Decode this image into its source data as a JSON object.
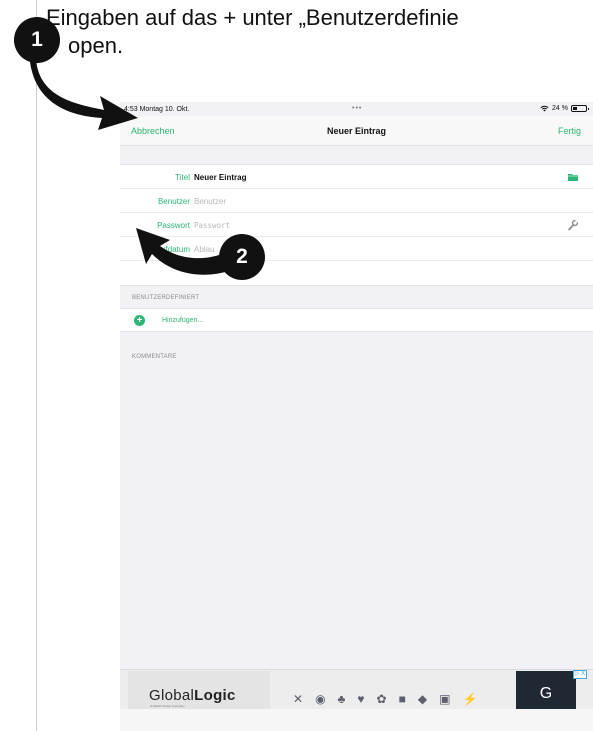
{
  "instruction": {
    "line1": "Eingaben auf das + unter „Benutzerdefinie",
    "line2": "open."
  },
  "callouts": {
    "one": "1",
    "two": "2"
  },
  "statusbar": {
    "time": "4:53",
    "date": "Montag 10. Okt.",
    "dots": "•••",
    "battery": "24 %"
  },
  "navbar": {
    "cancel": "Abbrechen",
    "title": "Neuer Eintrag",
    "done": "Fertig"
  },
  "form": {
    "title_label": "Titel",
    "title_value": "Neuer Eintrag",
    "user_label": "Benutzer",
    "user_placeholder": "Benutzer",
    "password_label": "Passwort",
    "password_placeholder": "Passwort",
    "expiry_label": "Ablaufdatum",
    "expiry_placeholder": "Ablau"
  },
  "sections": {
    "custom": "BENUTZERDEFINIERT",
    "add": "Hinzufügen...",
    "comments": "KOMMENTARE"
  },
  "ad": {
    "brand_regular": "Global",
    "brand_bold": "Logic",
    "tagline": "A Hitachi Group Company",
    "cta": "G",
    "badge": "▷ X"
  },
  "colors": {
    "accent": "#2bb673",
    "background": "#f2f2f6"
  },
  "icons": {
    "title_row": "folder-icon",
    "password_row": "wrench-icon",
    "battery": "battery-icon",
    "wifi": "wifi-icon"
  }
}
